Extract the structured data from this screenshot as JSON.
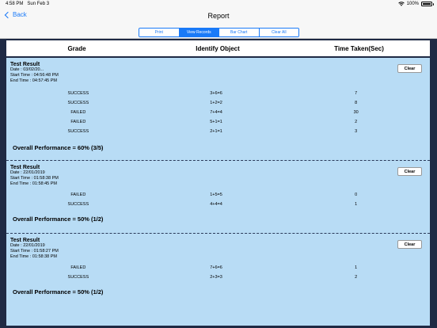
{
  "status": {
    "time": "4:58 PM",
    "date": "Sun Feb 3",
    "battery": "100%"
  },
  "nav": {
    "back_label": "Back",
    "title": "Report"
  },
  "segments": [
    {
      "label": "Print",
      "active": false
    },
    {
      "label": "View Records",
      "active": true
    },
    {
      "label": "Bar Chart",
      "active": false
    },
    {
      "label": "Clear All",
      "active": false
    }
  ],
  "table_header": {
    "grade": "Grade",
    "identify": "Identify Object",
    "time": "Time Taken(Sec)"
  },
  "results": [
    {
      "title": "Test Result",
      "date": "Date : 03/02/20...",
      "start": "Start Time : 04:56:48 PM",
      "end": "End Time   : 04:57:45 PM",
      "clear_label": "Clear",
      "rows": [
        {
          "grade": "SUCCESS",
          "object": "3+6=6",
          "time": "7"
        },
        {
          "grade": "SUCCESS",
          "object": "1+2=2",
          "time": "8"
        },
        {
          "grade": "FAILED",
          "object": "7+4=4",
          "time": "30"
        },
        {
          "grade": "FAILED",
          "object": "5+1=1",
          "time": "2"
        },
        {
          "grade": "SUCCESS",
          "object": "2+1=1",
          "time": "3"
        }
      ],
      "overall": "Overall Performance = 60% (3/5)"
    },
    {
      "title": "Test Result",
      "date": "Date : 22/01/2019",
      "start": "Start Time : 01:58:38 PM",
      "end": "End Time   : 01:58:45 PM",
      "clear_label": "Clear",
      "rows": [
        {
          "grade": "FAILED",
          "object": "1+5=5",
          "time": "0"
        },
        {
          "grade": "SUCCESS",
          "object": "4+4=4",
          "time": "1"
        }
      ],
      "overall": "Overall Performance = 50% (1/2)"
    },
    {
      "title": "Test Result",
      "date": "Date : 22/01/2019",
      "start": "Start Time : 01:58:27 PM",
      "end": "End Time   : 01:58:38 PM",
      "clear_label": "Clear",
      "rows": [
        {
          "grade": "FAILED",
          "object": "7+6=6",
          "time": "1"
        },
        {
          "grade": "SUCCESS",
          "object": "2+3=3",
          "time": "2"
        }
      ],
      "overall": "Overall Performance = 50% (1/2)"
    }
  ]
}
